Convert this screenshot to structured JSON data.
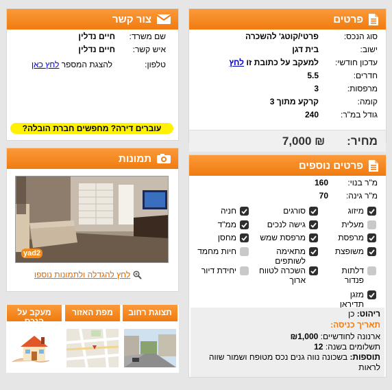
{
  "details": {
    "title": "פרטים",
    "rows": [
      {
        "label": "סוג הנכס:",
        "value": "פרטי/קוטג' להשכרה"
      },
      {
        "label": "ישוב:",
        "value": "בית דגן"
      },
      {
        "label": "עדכון חודשי:",
        "value": "למעקב על כתובת זו",
        "link": "לחץ"
      },
      {
        "label": "חדרים:",
        "value": "5.5"
      },
      {
        "label": "מרפסות:",
        "value": "3"
      },
      {
        "label": "קומה:",
        "value": "קרקע מתוך 3"
      },
      {
        "label": "גודל במ\"ר:",
        "value": "240"
      }
    ],
    "price_label": "מחיר:",
    "price_value": "7,000 ₪"
  },
  "contact": {
    "title": "צור קשר",
    "office_label": "שם משרד:",
    "office_value": "חיים נדלין",
    "person_label": "איש קשר:",
    "person_value": "חיים נדלין",
    "phone_label": "טלפון:",
    "phone_text": "להצגת המספר",
    "phone_link": "לחץ כאן",
    "moving_banner": "עוברים דירה? מחפשים חברת הובלה?"
  },
  "photos": {
    "title": "תמונות",
    "watermark": "yad2",
    "enlarge_link": "לחץ להגדלה ולתמונות נוספו"
  },
  "tabs": [
    {
      "label": "תצוגת רחוב"
    },
    {
      "label": "מפת האזור"
    },
    {
      "label": "מעקב על הנכס"
    }
  ],
  "extra": {
    "title": "פרטים נוספים",
    "built_label": "מ\"ר בנוי:",
    "built_value": "160",
    "garden_label": "מ\"ר גינה:",
    "garden_value": "70",
    "features": [
      {
        "label": "מיזוג",
        "checked": true
      },
      {
        "label": "סורגים",
        "checked": true
      },
      {
        "label": "חניה",
        "checked": true
      },
      {
        "label": "מעלית",
        "checked": false
      },
      {
        "label": "גישה לנכים",
        "checked": true
      },
      {
        "label": "ממ\"ד",
        "checked": true
      },
      {
        "label": "מרפסת",
        "checked": true
      },
      {
        "label": "מרפסת שמש",
        "checked": true
      },
      {
        "label": "מחסן",
        "checked": true
      },
      {
        "label": "משופצת",
        "checked": true
      },
      {
        "label": "מתאימה לשותפים",
        "checked": true
      },
      {
        "label": "חיות מחמד",
        "checked": false
      },
      {
        "label": "דלתות פנדור",
        "checked": false
      },
      {
        "label": "השכרה לטווח ארוך",
        "checked": true
      },
      {
        "label": "יחידת דיור",
        "checked": false
      },
      {
        "label": "מזגן תדיראן",
        "checked": true
      }
    ],
    "furniture_label": "ריהוט:",
    "furniture_value": "כן",
    "entry_label": "תאריך כניסה:",
    "rent_label": "ארנונה לחודשיים:",
    "rent_value": "₪1,000",
    "payments_label": "תשלומים בשנה:",
    "payments_value": "12",
    "additions_label": "תוספות:",
    "additions_value": "בשכונה נווה גנים נכס מטופח ושמור שווה לראות"
  }
}
